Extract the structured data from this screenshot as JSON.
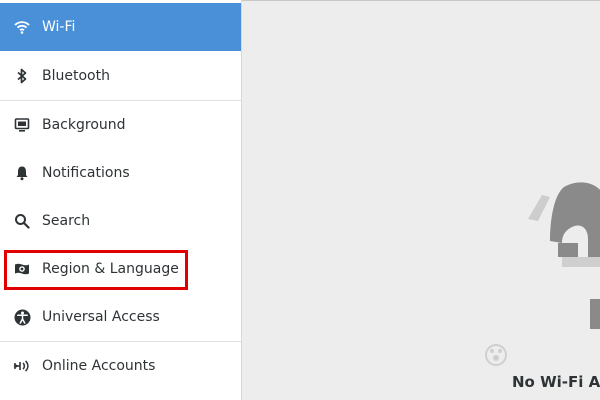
{
  "sidebar": {
    "items": [
      {
        "label": "Wi-Fi",
        "icon": "wifi-icon",
        "active": true
      },
      {
        "label": "Bluetooth",
        "icon": "bluetooth-icon",
        "active": false
      },
      {
        "label": "Background",
        "icon": "background-icon",
        "active": false
      },
      {
        "label": "Notifications",
        "icon": "bell-icon",
        "active": false
      },
      {
        "label": "Search",
        "icon": "search-icon",
        "active": false
      },
      {
        "label": "Region & Language",
        "icon": "region-icon",
        "active": false,
        "highlighted": true
      },
      {
        "label": "Universal Access",
        "icon": "accessibility-icon",
        "active": false
      },
      {
        "label": "Online Accounts",
        "icon": "online-accounts-icon",
        "active": false
      }
    ]
  },
  "main": {
    "empty_state": {
      "title": "No Wi-Fi A"
    }
  },
  "colors": {
    "active_bg": "#4a90d9",
    "highlight_border": "#e10000",
    "content_bg": "#ededed"
  }
}
